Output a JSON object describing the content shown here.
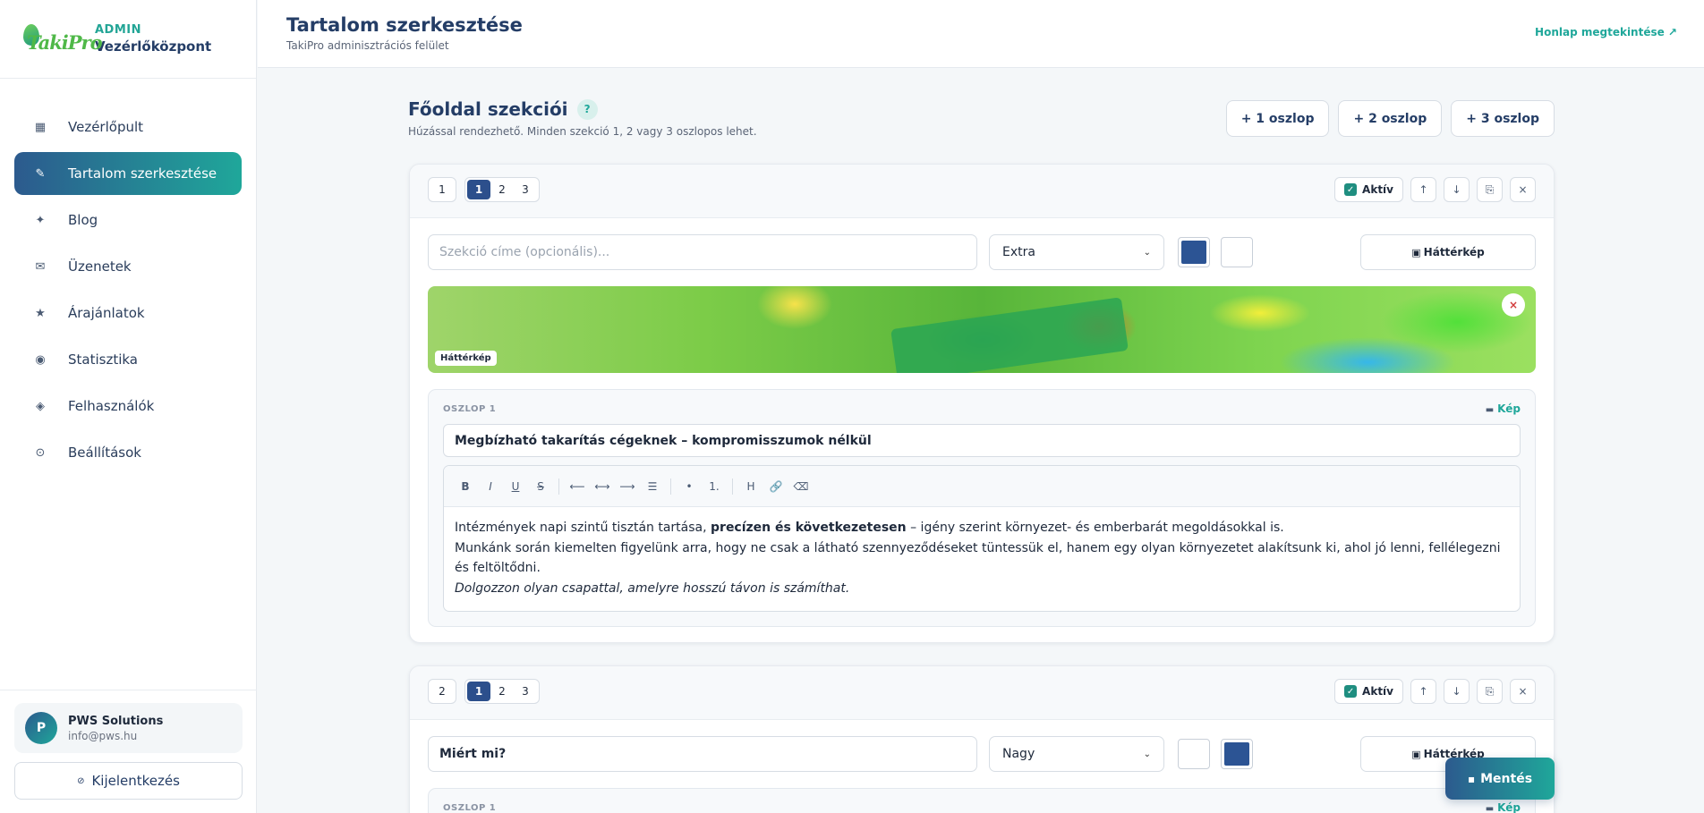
{
  "brand": {
    "logo_text_a": "Taki",
    "logo_text_b": "Pro",
    "sub": "ADMIN",
    "title": "Vezérlőközpont"
  },
  "nav": [
    {
      "label": "Vezérlőpult",
      "icon": "grid-icon",
      "glyph": "▦"
    },
    {
      "label": "Tartalom szerkesztése",
      "icon": "pencil-icon",
      "glyph": "✎"
    },
    {
      "label": "Blog",
      "icon": "sparkle-icon",
      "glyph": "✦"
    },
    {
      "label": "Üzenetek",
      "icon": "mail-icon",
      "glyph": "✉"
    },
    {
      "label": "Árajánlatok",
      "icon": "star-icon",
      "glyph": "★"
    },
    {
      "label": "Statisztika",
      "icon": "chart-icon",
      "glyph": "◉"
    },
    {
      "label": "Felhasználók",
      "icon": "users-icon",
      "glyph": "◈"
    },
    {
      "label": "Beállítások",
      "icon": "gear-icon",
      "glyph": "⊙"
    }
  ],
  "user": {
    "initial": "P",
    "name": "PWS Solutions",
    "email": "info@pws.hu"
  },
  "logout_label": "Kijelentkezés",
  "header": {
    "title": "Tartalom szerkesztése",
    "subtitle": "TakiPro adminisztrációs felület",
    "view_site": "Honlap megtekintése ↗"
  },
  "sections_header": {
    "title": "Főoldal szekciói",
    "help": "?",
    "subtitle": "Húzással rendezhető. Minden szekció 1, 2 vagy 3 oszlopos lehet.",
    "add_buttons": [
      "+ 1 oszlop",
      "+ 2 oszlop",
      "+ 3 oszlop"
    ]
  },
  "sections": [
    {
      "number": "1",
      "columns_options": [
        "1",
        "2",
        "3"
      ],
      "active_label": "Aktív",
      "title_placeholder": "Szekció címe (opcionális)...",
      "title_value": "",
      "size": "Extra",
      "colors": [
        "#2c5494",
        "#ffffff"
      ],
      "bg_button": "Háttérkép",
      "bg_tag": "Háttérkép",
      "column": {
        "label": "OSZLOP 1",
        "image_button": "Kép",
        "heading": "Megbízható takarítás cégeknek – kompromisszumok nélkül",
        "body": {
          "line1_pre": "Intézmények napi szintű tisztán tartása, ",
          "line1_bold": "precízen és következetesen",
          "line1_post": " – igény szerint környezet- és emberbarát megoldásokkal is.",
          "line2": "Munkánk során kiemelten figyelünk arra, hogy ne csak a látható szennyeződéseket tüntessük el, hanem egy olyan környezetet alakítsunk ki, ahol jó lenni, fellélegezni és feltöltődni.",
          "line3": "Dolgozzon olyan csapattal, amelyre hosszú távon is számíthat."
        }
      }
    },
    {
      "number": "2",
      "columns_options": [
        "1",
        "2",
        "3"
      ],
      "active_label": "Aktív",
      "title_value": "Miért mi?",
      "size": "Nagy",
      "colors": [
        "#ffffff",
        "#2c5494"
      ],
      "bg_button": "Háttérkép",
      "column": {
        "label": "OSZLOP 1",
        "image_button": "Kép"
      }
    }
  ],
  "toolbar": [
    "B",
    "I",
    "U",
    "S",
    "⟵",
    "⟷",
    "⟶",
    "☰",
    "•",
    "1.",
    "H",
    "🔗",
    "⌫"
  ],
  "save_label": "Mentés"
}
